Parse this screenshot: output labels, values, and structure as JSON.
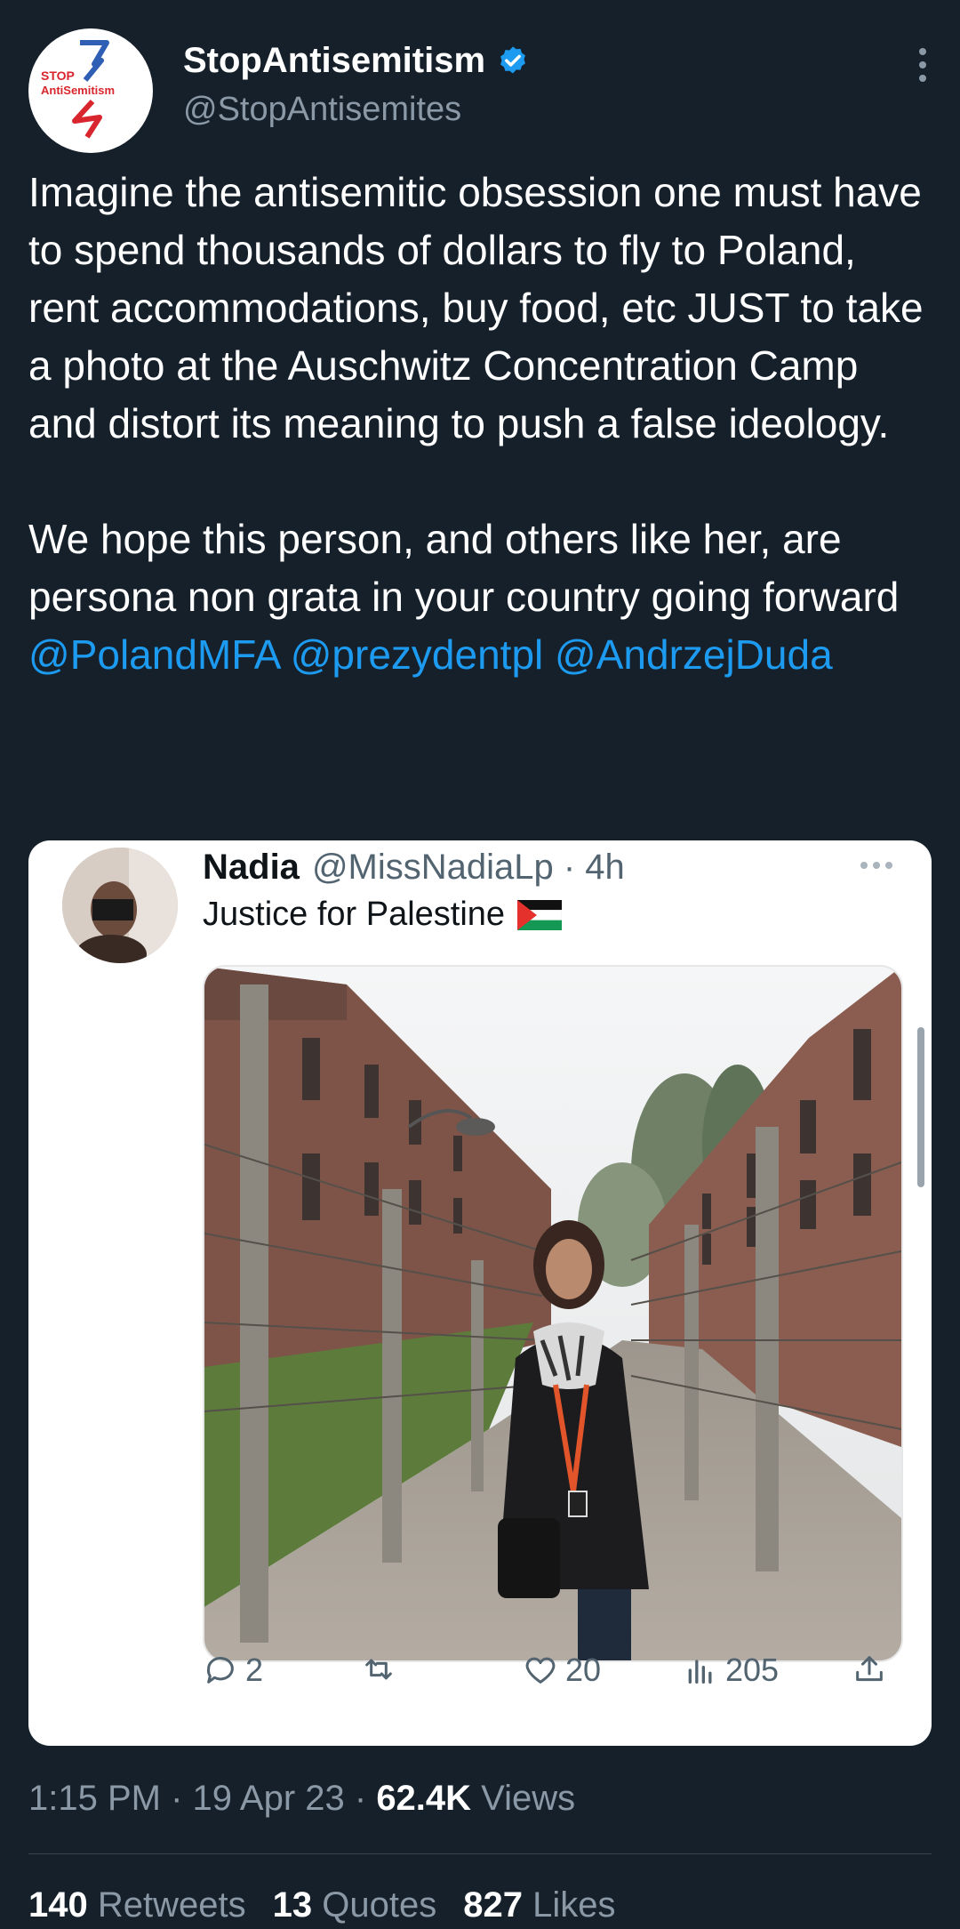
{
  "author": {
    "name": "StopAntisemitism",
    "handle": "@StopAntisemites",
    "logo_text_top": "STOP",
    "logo_text_bottom": "AntiSemitism"
  },
  "tweet": {
    "paragraph1": "Imagine the antisemitic obsession one must have to spend thousands of dollars to fly to Poland, rent accommodations, buy food, etc JUST to take a photo at the Auschwitz Concentration Camp and distort its meaning to push a false ideology.",
    "paragraph2_text": "We hope this person, and others like her, are persona non grata in your country going forward",
    "mentions": [
      "@PolandMFA",
      "@prezydentpl",
      "@AndrzejDuda"
    ]
  },
  "quoted": {
    "name": "Nadia",
    "meta": "@MissNadiaLp · 4h",
    "text": "Justice for Palestine",
    "actions": {
      "replies": "2",
      "retweets": "",
      "likes": "20",
      "views": "205"
    }
  },
  "footer": {
    "time": "1:15 PM · 19 Apr 23 · ",
    "views_count": "62.4K",
    "views_label": " Views",
    "retweets_count": "140",
    "retweets_label": "Retweets",
    "quotes_count": "13",
    "quotes_label": "Quotes",
    "likes_count": "827",
    "likes_label": "Likes"
  },
  "colors": {
    "background": "#15202b",
    "link": "#1d9bf0",
    "muted": "#8b98a5"
  },
  "icons": [
    "verified-badge-icon",
    "more-icon",
    "reply-icon",
    "retweet-icon",
    "like-icon",
    "views-icon",
    "share-icon"
  ]
}
